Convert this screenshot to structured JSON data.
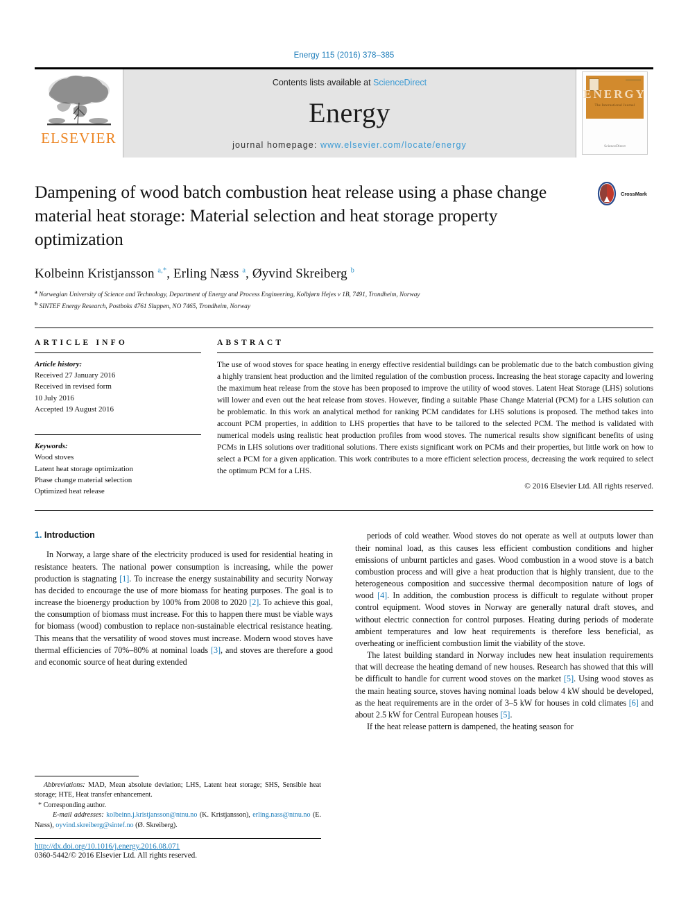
{
  "running_head": "Energy 115 (2016) 378–385",
  "masthead": {
    "publisher_name": "ELSEVIER",
    "contents_prefix": "Contents lists available at ",
    "contents_link": "ScienceDirect",
    "journal_title": "Energy",
    "homepage_prefix": "journal homepage: ",
    "homepage_url": "www.elsevier.com/locate/energy",
    "cover": {
      "title": "ENERGY",
      "subtitle": "The International Journal",
      "footer": "Available online at\nScienceDirect\nwww.sciencedirect.com"
    }
  },
  "article": {
    "title": "Dampening of wood batch combustion heat release using a phase change material heat storage: Material selection and heat storage property optimization",
    "crossmark_label": "CrossMark",
    "authors_html": "Kolbeinn Kristjansson <sup>a,</sup><sup>*</sup>, Erling Næss <sup>a</sup>, Øyvind Skreiberg <sup>b</sup>",
    "affiliations": [
      "Norwegian University of Science and Technology, Department of Energy and Process Engineering, Kolbjørn Hejes v 1B, 7491, Trondheim, Norway",
      "SINTEF Energy Research, Postboks 4761 Sluppen, NO 7465, Trondheim, Norway"
    ],
    "affiliation_marks": [
      "a",
      "b"
    ]
  },
  "article_info": {
    "heading": "ARTICLE INFO",
    "history_label": "Article history:",
    "history": [
      "Received 27 January 2016",
      "Received in revised form",
      "10 July 2016",
      "Accepted 19 August 2016"
    ],
    "keywords_label": "Keywords:",
    "keywords": [
      "Wood stoves",
      "Latent heat storage optimization",
      "Phase change material selection",
      "Optimized heat release"
    ]
  },
  "abstract": {
    "heading": "ABSTRACT",
    "text": "The use of wood stoves for space heating in energy effective residential buildings can be problematic due to the batch combustion giving a highly transient heat production and the limited regulation of the combustion process. Increasing the heat storage capacity and lowering the maximum heat release from the stove has been proposed to improve the utility of wood stoves. Latent Heat Storage (LHS) solutions will lower and even out the heat release from stoves. However, finding a suitable Phase Change Material (PCM) for a LHS solution can be problematic. In this work an analytical method for ranking PCM candidates for LHS solutions is proposed. The method takes into account PCM properties, in addition to LHS properties that have to be tailored to the selected PCM. The method is validated with numerical models using realistic heat production profiles from wood stoves. The numerical results show significant benefits of using PCMs in LHS solutions over traditional solutions. There exists significant work on PCMs and their properties, but little work on how to select a PCM for a given application. This work contributes to a more efficient selection process, decreasing the work required to select the optimum PCM for a LHS.",
    "copyright": "© 2016 Elsevier Ltd. All rights reserved."
  },
  "body": {
    "section_number": "1.",
    "section_title": "Introduction",
    "left_column": [
      "In Norway, a large share of the electricity produced is used for residential heating in resistance heaters. The national power consumption is increasing, while the power production is stagnating [1]. To increase the energy sustainability and security Norway has decided to encourage the use of more biomass for heating purposes. The goal is to increase the bioenergy production by 100% from 2008 to 2020 [2]. To achieve this goal, the consumption of biomass must increase. For this to happen there must be viable ways for biomass (wood) combustion to replace non-sustainable electrical resistance heating. This means that the versatility of wood stoves must increase. Modern wood stoves have thermal efficiencies of 70%–80% at nominal loads [3], and stoves are therefore a good and economic source of heat during extended"
    ],
    "right_column": [
      "periods of cold weather. Wood stoves do not operate as well at outputs lower than their nominal load, as this causes less efficient combustion conditions and higher emissions of unburnt particles and gases. Wood combustion in a wood stove is a batch combustion process and will give a heat production that is highly transient, due to the heterogeneous composition and successive thermal decomposition nature of logs of wood [4]. In addition, the combustion process is difficult to regulate without proper control equipment. Wood stoves in Norway are generally natural draft stoves, and without electric connection for control purposes. Heating during periods of moderate ambient temperatures and low heat requirements is therefore less beneficial, as overheating or inefficient combustion limit the viability of the stove.",
      "The latest building standard in Norway includes new heat insulation requirements that will decrease the heating demand of new houses. Research has showed that this will be difficult to handle for current wood stoves on the market [5]. Using wood stoves as the main heating source, stoves having nominal loads below 4 kW should be developed, as the heat requirements are in the order of 3–5 kW for houses in cold climates [6] and about 2.5 kW for Central European houses [5].",
      "If the heat release pattern is dampened, the heating season for"
    ]
  },
  "footnotes": {
    "abbreviations_label": "Abbreviations:",
    "abbreviations_text": "MAD, Mean absolute deviation; LHS, Latent heat storage; SHS, Sensible heat storage; HTE, Heat transfer enhancement.",
    "corresponding_author": "Corresponding author.",
    "email_label": "E-mail addresses:",
    "emails": [
      {
        "address": "kolbeinn.j.kristjansson@ntnu.no",
        "name": "(K. Kristjansson)"
      },
      {
        "address": "erling.nass@ntnu.no",
        "name": "(E. Næss)"
      },
      {
        "address": "oyvind.skreiberg@sintef.no",
        "name": "(Ø. Skreiberg)"
      }
    ]
  },
  "footer": {
    "doi": "http://dx.doi.org/10.1016/j.energy.2016.08.071",
    "issn_line": "0360-5442/© 2016 Elsevier Ltd. All rights reserved."
  },
  "colors": {
    "link_blue": "#1a7bb9",
    "science_direct_blue": "#3b9ad4",
    "elsevier_orange": "#ec8523",
    "cover_orange": "#d28a2d"
  }
}
